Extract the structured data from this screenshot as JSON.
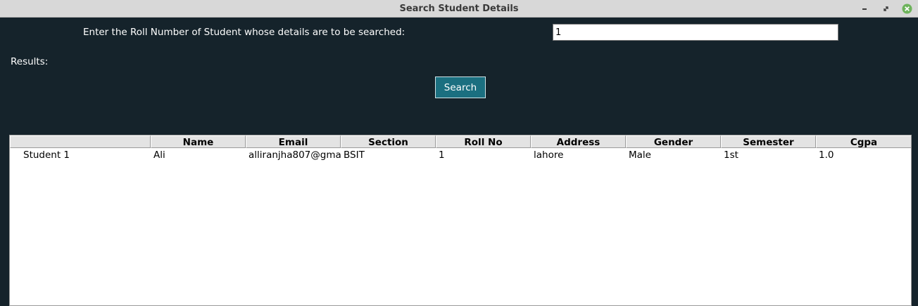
{
  "window": {
    "title": "Search Student Details",
    "controls": {
      "minimize_icon": "minimize-icon",
      "maximize_icon": "maximize-icon",
      "close_icon": "close-icon",
      "close_color": "#6db35b"
    }
  },
  "form": {
    "prompt_label": "Enter the Roll Number of Student whose details are to be searched:",
    "roll_input_value": "1",
    "results_label": "Results:",
    "search_button": "Search"
  },
  "colors": {
    "background": "#15232b",
    "button": "#1b6f80"
  },
  "table": {
    "columns": [
      "",
      "Name",
      "Email",
      "Section",
      "Roll No",
      "Address",
      "Gender",
      "Semester",
      "Cgpa"
    ],
    "rows": [
      {
        "id": "Student 1",
        "cells": [
          "Ali",
          "alliranjha807@gma",
          "BSIT",
          "1",
          "lahore",
          "Male",
          "1st",
          "1.0"
        ]
      }
    ]
  }
}
